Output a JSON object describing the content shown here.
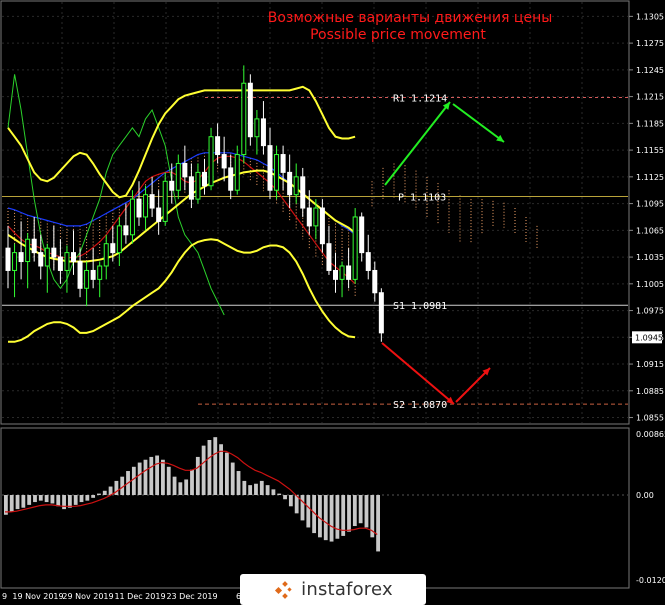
{
  "colors": {
    "background": "#000000",
    "grid": "#2a2a2a",
    "bull": "#33ff33",
    "bear": "#ffffff",
    "bollinger": "#ffff33",
    "red_line": "#cc1111",
    "blue_line": "#1a3cff",
    "green_line": "#2bd12b",
    "cloud": "#f5a46a",
    "pivot_line": "#b9a33a",
    "r1_line": "#d45a5a",
    "s_line": "#c86040",
    "arrow_up": "#22ee22",
    "arrow_down": "#ee1111",
    "title": "#ff1a1a"
  },
  "title": {
    "line1": "Возможные варианты движения цены",
    "line2": "Possible price movement"
  },
  "logo": {
    "text": "instaforex"
  },
  "chart_data": [
    {
      "type": "candlestick",
      "panel": "price",
      "ylim": [
        1.085,
        1.132
      ],
      "y_ticks": [
        "1.1305",
        "1.1275",
        "1.1245",
        "1.1215",
        "1.1185",
        "1.1155",
        "1.1125",
        "1.1095",
        "1.1065",
        "1.1035",
        "1.1005",
        "1.0975",
        "1.0945",
        "1.0915",
        "1.0885",
        "1.0855"
      ],
      "current_price": "1.0945",
      "x_ticks": [
        "9",
        "19 Nov 2019",
        "29 Nov 2019",
        "11 Dec 2019",
        "23 Dec 2019",
        "6 Jan"
      ],
      "levels": [
        {
          "label": "R1",
          "value": "1.1214",
          "v": 1.1214
        },
        {
          "label": "P",
          "value": "1.1103",
          "v": 1.1103
        },
        {
          "label": "S1",
          "value": "1.0981",
          "v": 1.0981
        },
        {
          "label": "S2",
          "value": "1.0870",
          "v": 1.087
        }
      ],
      "candles": [
        [
          1.1045,
          1.107,
          1.1,
          1.102
        ],
        [
          1.102,
          1.105,
          1.099,
          1.104
        ],
        [
          1.104,
          1.1075,
          1.101,
          1.103
        ],
        [
          1.103,
          1.1062,
          1.1,
          1.1055
        ],
        [
          1.1055,
          1.108,
          1.103,
          1.104
        ],
        [
          1.104,
          1.106,
          1.101,
          1.1025
        ],
        [
          1.1025,
          1.105,
          1.0995,
          1.1045
        ],
        [
          1.1045,
          1.107,
          1.102,
          1.1035
        ],
        [
          1.1035,
          1.1055,
          1.1005,
          1.102
        ],
        [
          1.102,
          1.1048,
          1.0995,
          1.104
        ],
        [
          1.104,
          1.1065,
          1.1015,
          1.103
        ],
        [
          1.103,
          1.1045,
          1.099,
          1.1
        ],
        [
          1.1,
          1.103,
          1.098,
          1.102
        ],
        [
          1.102,
          1.1045,
          1.1,
          1.101
        ],
        [
          1.101,
          1.103,
          1.099,
          1.1025
        ],
        [
          1.1025,
          1.106,
          1.101,
          1.105
        ],
        [
          1.105,
          1.107,
          1.103,
          1.104
        ],
        [
          1.104,
          1.108,
          1.1025,
          1.107
        ],
        [
          1.107,
          1.1095,
          1.105,
          1.106
        ],
        [
          1.106,
          1.111,
          1.105,
          1.11
        ],
        [
          1.11,
          1.112,
          1.107,
          1.108
        ],
        [
          1.108,
          1.1115,
          1.1065,
          1.1105
        ],
        [
          1.1105,
          1.1125,
          1.108,
          1.109
        ],
        [
          1.109,
          1.111,
          1.106,
          1.1075
        ],
        [
          1.1075,
          1.113,
          1.107,
          1.112
        ],
        [
          1.112,
          1.114,
          1.1095,
          1.111
        ],
        [
          1.111,
          1.115,
          1.11,
          1.114
        ],
        [
          1.114,
          1.116,
          1.111,
          1.1125
        ],
        [
          1.1125,
          1.114,
          1.109,
          1.11
        ],
        [
          1.11,
          1.114,
          1.1095,
          1.113
        ],
        [
          1.113,
          1.1145,
          1.1105,
          1.1115
        ],
        [
          1.1115,
          1.118,
          1.111,
          1.117
        ],
        [
          1.117,
          1.1185,
          1.114,
          1.115
        ],
        [
          1.115,
          1.117,
          1.112,
          1.1135
        ],
        [
          1.1135,
          1.115,
          1.11,
          1.111
        ],
        [
          1.111,
          1.116,
          1.1105,
          1.115
        ],
        [
          1.115,
          1.125,
          1.114,
          1.123
        ],
        [
          1.123,
          1.124,
          1.116,
          1.117
        ],
        [
          1.117,
          1.12,
          1.115,
          1.119
        ],
        [
          1.119,
          1.121,
          1.115,
          1.116
        ],
        [
          1.116,
          1.118,
          1.11,
          1.111
        ],
        [
          1.111,
          1.116,
          1.11,
          1.115
        ],
        [
          1.115,
          1.116,
          1.111,
          1.113
        ],
        [
          1.113,
          1.115,
          1.109,
          1.1105
        ],
        [
          1.1105,
          1.114,
          1.1095,
          1.1125
        ],
        [
          1.1125,
          1.1135,
          1.108,
          1.109
        ],
        [
          1.109,
          1.111,
          1.106,
          1.107
        ],
        [
          1.107,
          1.11,
          1.1055,
          1.109
        ],
        [
          1.109,
          1.11,
          1.104,
          1.105
        ],
        [
          1.105,
          1.107,
          1.1015,
          1.102
        ],
        [
          1.102,
          1.104,
          1.0995,
          1.101
        ],
        [
          1.101,
          1.103,
          1.099,
          1.1025
        ],
        [
          1.1025,
          1.1045,
          1.1,
          1.101
        ],
        [
          1.101,
          1.109,
          1.1005,
          1.108
        ],
        [
          1.108,
          1.1085,
          1.103,
          1.104
        ],
        [
          1.104,
          1.106,
          1.101,
          1.102
        ],
        [
          1.102,
          1.103,
          1.0985,
          1.0995
        ],
        [
          1.0995,
          1.1,
          1.094,
          1.095
        ]
      ],
      "bollinger_upper": [
        1.118,
        1.117,
        1.116,
        1.1145,
        1.113,
        1.1122,
        1.112,
        1.1124,
        1.1132,
        1.114,
        1.1148,
        1.1152,
        1.115,
        1.114,
        1.1128,
        1.1118,
        1.1108,
        1.1102,
        1.1104,
        1.1116,
        1.1132,
        1.115,
        1.1168,
        1.1184,
        1.1196,
        1.1204,
        1.1212,
        1.1216,
        1.1218,
        1.122,
        1.1222,
        1.1222,
        1.1222,
        1.1222,
        1.1222,
        1.1222,
        1.1222,
        1.1222,
        1.1222,
        1.1222,
        1.1222,
        1.1222,
        1.1222,
        1.1222,
        1.1224,
        1.1226,
        1.1222,
        1.121,
        1.1195,
        1.118,
        1.117,
        1.1168,
        1.1168,
        1.117
      ],
      "bollinger_middle": [
        1.106,
        1.1055,
        1.105,
        1.1046,
        1.1042,
        1.1038,
        1.1035,
        1.1033,
        1.1032,
        1.103,
        1.103,
        1.103,
        1.103,
        1.1031,
        1.1032,
        1.1034,
        1.1036,
        1.104,
        1.1046,
        1.1052,
        1.1058,
        1.1064,
        1.107,
        1.1076,
        1.1082,
        1.1088,
        1.1094,
        1.11,
        1.1106,
        1.111,
        1.1114,
        1.1118,
        1.1121,
        1.1124,
        1.1126,
        1.1128,
        1.113,
        1.1131,
        1.1132,
        1.1132,
        1.113,
        1.1126,
        1.1122,
        1.1118,
        1.1112,
        1.1106,
        1.11,
        1.1094,
        1.1088,
        1.1082,
        1.1076,
        1.1072,
        1.1068,
        1.1062
      ],
      "bollinger_lower": [
        1.094,
        1.094,
        1.0942,
        1.0946,
        1.0952,
        1.0956,
        1.096,
        1.0962,
        1.0962,
        1.096,
        1.0956,
        1.095,
        1.095,
        1.0952,
        1.0956,
        1.096,
        1.0964,
        1.0968,
        1.0974,
        1.098,
        1.0985,
        1.099,
        1.0995,
        1.1,
        1.1008,
        1.1018,
        1.103,
        1.104,
        1.1048,
        1.1052,
        1.1054,
        1.1055,
        1.1054,
        1.105,
        1.1046,
        1.1042,
        1.104,
        1.104,
        1.1042,
        1.1046,
        1.1048,
        1.1048,
        1.1046,
        1.104,
        1.103,
        1.1016,
        1.1,
        1.0986,
        1.0974,
        1.0964,
        1.0956,
        1.095,
        1.0946,
        1.0945
      ],
      "red_line": [
        1.107,
        1.1062,
        1.1055,
        1.105,
        1.1048,
        1.1045,
        1.104,
        1.1038,
        1.1035,
        1.1034,
        1.1035,
        1.1036,
        1.104,
        1.1046,
        1.1052,
        1.106,
        1.107,
        1.108,
        1.109,
        1.11,
        1.111,
        1.112,
        1.1125,
        1.1128,
        1.113,
        1.113,
        1.1126,
        1.112,
        1.1118,
        1.1122,
        1.113,
        1.114,
        1.1146,
        1.1148,
        1.1148,
        1.1146,
        1.1142,
        1.1136,
        1.113,
        1.1124,
        1.1118,
        1.111,
        1.11,
        1.109,
        1.108,
        1.107,
        1.106,
        1.105,
        1.104,
        1.103,
        1.1024,
        1.1018,
        1.1012,
        1.1005
      ],
      "blue_line": [
        1.109,
        1.1088,
        1.1085,
        1.1082,
        1.108,
        1.1078,
        1.1076,
        1.1074,
        1.1072,
        1.107,
        1.107,
        1.107,
        1.1072,
        1.1076,
        1.108,
        1.1084,
        1.1088,
        1.1092,
        1.1096,
        1.11,
        1.1106,
        1.1112,
        1.1118,
        1.1124,
        1.113,
        1.1134,
        1.1138,
        1.1142,
        1.1146,
        1.115,
        1.1152,
        1.1152,
        1.1152,
        1.1152,
        1.1152,
        1.115,
        1.1148,
        1.1146,
        1.1144,
        1.114,
        1.1136,
        1.113,
        1.1124,
        1.1118,
        1.1112,
        1.1106,
        1.11,
        1.1094,
        1.1088,
        1.1082,
        1.1076,
        1.107,
        1.1066,
        1.106
      ],
      "green_line": [
        1.118,
        1.124,
        1.12,
        1.115,
        1.11,
        1.106,
        1.103,
        1.101,
        1.1,
        1.101,
        1.103,
        1.104,
        1.106,
        1.108,
        1.11,
        1.113,
        1.115,
        1.116,
        1.117,
        1.118,
        1.117,
        1.119,
        1.12,
        1.118,
        1.116,
        1.112,
        1.108,
        1.106,
        1.105,
        1.104,
        1.102,
        1.1,
        1.0985,
        1.097
      ]
    },
    {
      "type": "bar",
      "panel": "oscillator",
      "ylim": [
        -0.01205,
        0.00865
      ],
      "y_ticks": [
        "0.00865",
        "0.00",
        "-0.01205"
      ],
      "values": [
        -0.0028,
        -0.0024,
        -0.002,
        -0.0018,
        -0.0014,
        -0.001,
        -0.0008,
        -0.001,
        -0.0012,
        -0.0016,
        -0.002,
        -0.0018,
        -0.0014,
        -0.001,
        -0.0008,
        -0.0004,
        0.0002,
        0.0006,
        0.0012,
        0.002,
        0.0026,
        0.0034,
        0.004,
        0.0046,
        0.005,
        0.0054,
        0.0056,
        0.005,
        0.004,
        0.0026,
        0.0018,
        0.0022,
        0.0036,
        0.0054,
        0.007,
        0.0078,
        0.0082,
        0.0072,
        0.006,
        0.0046,
        0.0034,
        0.002,
        0.0014,
        0.0016,
        0.002,
        0.0014,
        0.0008,
        0.0002,
        -0.0006,
        -0.0016,
        -0.0026,
        -0.0036,
        -0.0046,
        -0.0054,
        -0.006,
        -0.0064,
        -0.0066,
        -0.0062,
        -0.0058,
        -0.0052,
        -0.0044,
        -0.004,
        -0.0046,
        -0.006,
        -0.008
      ],
      "signal": [
        -0.0024,
        -0.0024,
        -0.0023,
        -0.0021,
        -0.0019,
        -0.0017,
        -0.0015,
        -0.0014,
        -0.0014,
        -0.0015,
        -0.0016,
        -0.0016,
        -0.0016,
        -0.0015,
        -0.0013,
        -0.0011,
        -0.0008,
        -0.0005,
        -0.0001,
        0.0004,
        0.001,
        0.0016,
        0.0022,
        0.0028,
        0.0034,
        0.0039,
        0.0044,
        0.0046,
        0.0045,
        0.0042,
        0.0038,
        0.0035,
        0.0035,
        0.0038,
        0.0045,
        0.0052,
        0.0058,
        0.0062,
        0.0062,
        0.0058,
        0.0053,
        0.0046,
        0.004,
        0.0035,
        0.0032,
        0.0028,
        0.0024,
        0.002,
        0.0014,
        0.0008,
        0.0,
        -0.0008,
        -0.0016,
        -0.0024,
        -0.0032,
        -0.0038,
        -0.0044,
        -0.0048,
        -0.005,
        -0.005,
        -0.0049,
        -0.0047,
        -0.0047,
        -0.005,
        -0.0056
      ]
    }
  ]
}
